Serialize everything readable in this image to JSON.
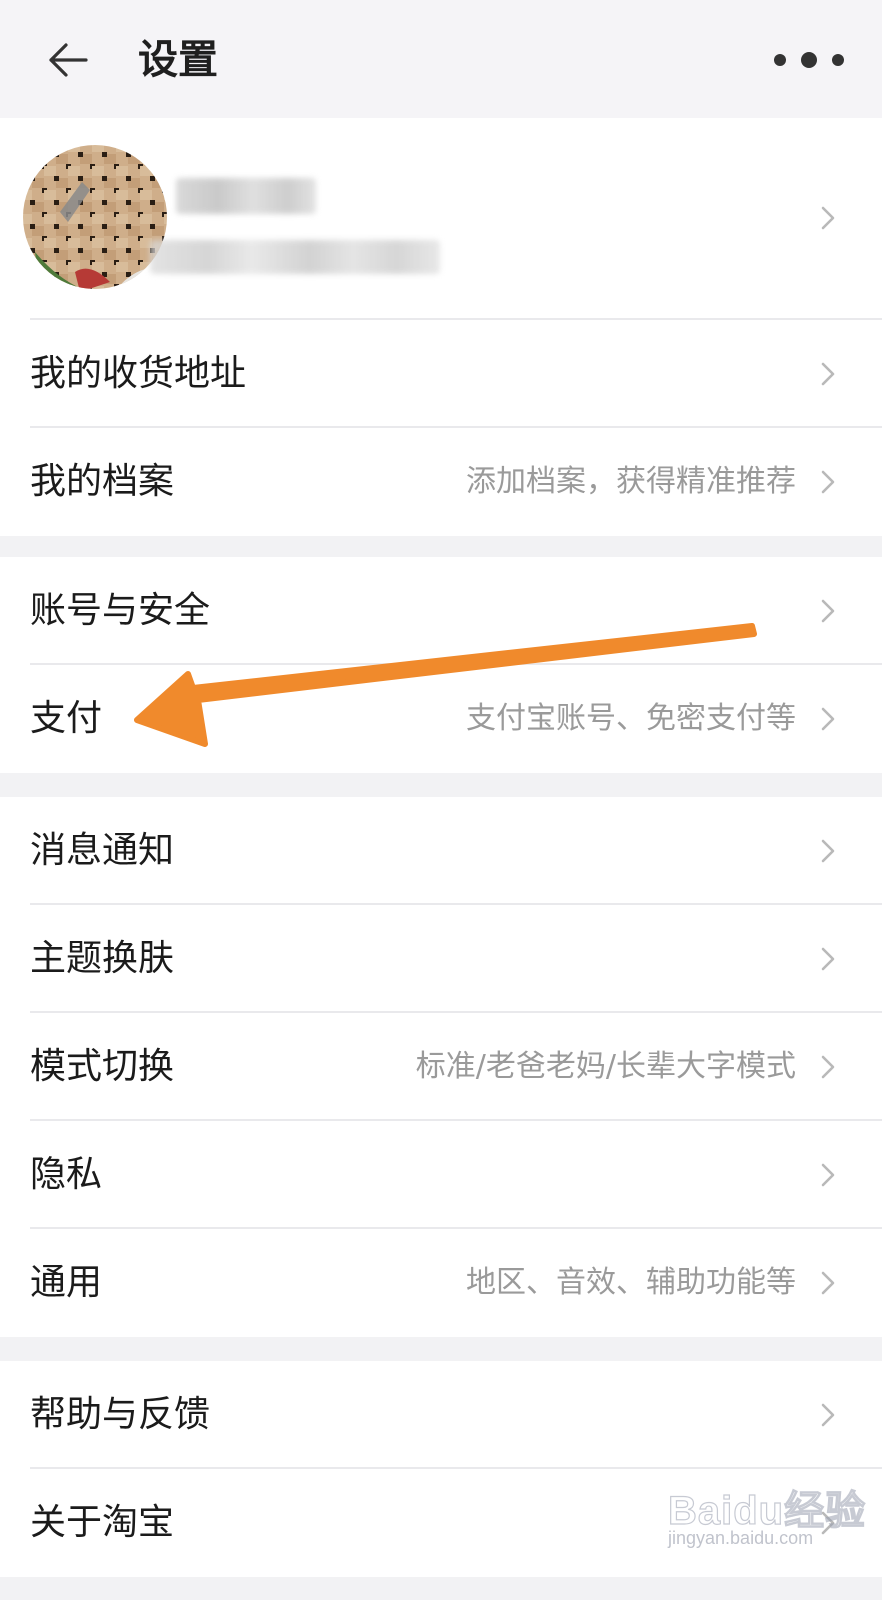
{
  "header": {
    "title": "设置"
  },
  "profile": {},
  "sections": [
    {
      "rows": [
        {
          "label": "我的收货地址",
          "hint": ""
        },
        {
          "label": "我的档案",
          "hint": "添加档案，获得精准推荐"
        }
      ]
    },
    {
      "rows": [
        {
          "label": "账号与安全",
          "hint": ""
        },
        {
          "label": "支付",
          "hint": "支付宝账号、免密支付等"
        }
      ]
    },
    {
      "rows": [
        {
          "label": "消息通知",
          "hint": ""
        },
        {
          "label": "主题换肤",
          "hint": ""
        },
        {
          "label": "模式切换",
          "hint": "标准/老爸老妈/长辈大字模式"
        },
        {
          "label": "隐私",
          "hint": ""
        },
        {
          "label": "通用",
          "hint": "地区、音效、辅助功能等"
        }
      ]
    },
    {
      "rows": [
        {
          "label": "帮助与反馈",
          "hint": ""
        },
        {
          "label": "关于淘宝",
          "hint": ""
        }
      ]
    }
  ],
  "watermark": {
    "logo": "Baidu经验",
    "sub": "jingyan.baidu.com"
  },
  "colors": {
    "background": "#f2f2f4",
    "card": "#ffffff",
    "hint_text": "#9a9a9a",
    "annotation_arrow": "#f08a2c"
  },
  "icons": {
    "back": "arrow-left-icon",
    "more": "more-dots-icon",
    "chevron": "chevron-right-icon"
  }
}
